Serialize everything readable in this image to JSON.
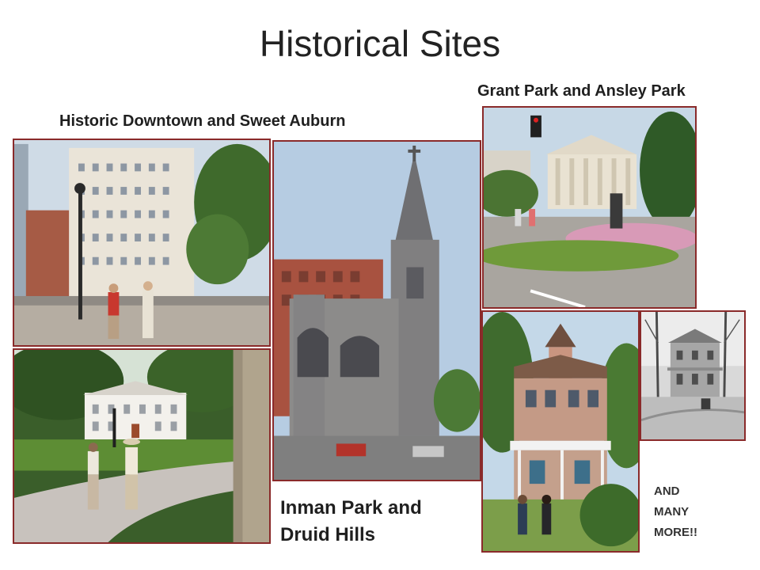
{
  "slide": {
    "title": "Historical Sites"
  },
  "captions": {
    "downtown": "Historic Downtown and Sweet Auburn",
    "grant": "Grant Park and Ansley Park",
    "inman_line1": "Inman Park and",
    "inman_line2": "Druid Hills",
    "more_line1": "AND",
    "more_line2": "MANY",
    "more_line3": "MORE!!"
  },
  "colors": {
    "frame": "#8a2a2a",
    "title_text": "#222222",
    "caption_text": "#1f1f1f"
  }
}
